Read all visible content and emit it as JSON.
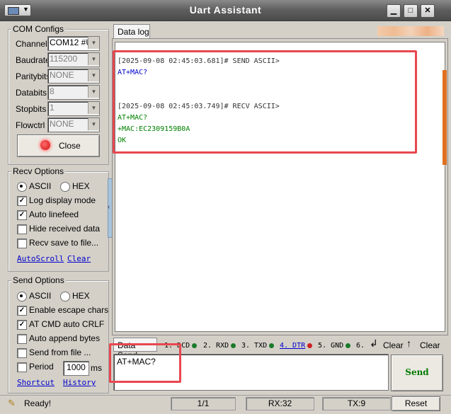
{
  "window": {
    "title": "Uart Assistant",
    "menu_icon": "monitor-icon"
  },
  "com_configs": {
    "legend": "COM Configs",
    "fields": [
      {
        "label": "Channel",
        "value": "COM12 #U",
        "disabled": false
      },
      {
        "label": "Baudrate",
        "value": "115200",
        "disabled": true
      },
      {
        "label": "Paritybits",
        "value": "NONE",
        "disabled": true
      },
      {
        "label": "Databits",
        "value": "8",
        "disabled": true
      },
      {
        "label": "Stopbits",
        "value": "1",
        "disabled": true
      },
      {
        "label": "Flowctrl",
        "value": "NONE",
        "disabled": true
      }
    ],
    "close_label": "Close"
  },
  "recv_options": {
    "legend": "Recv Options",
    "ascii": "ASCII",
    "hex": "HEX",
    "checks": [
      {
        "label": "Log display mode",
        "checked": true
      },
      {
        "label": "Auto linefeed",
        "checked": true
      },
      {
        "label": "Hide received data",
        "checked": false
      },
      {
        "label": "Recv save to file...",
        "checked": false
      }
    ],
    "autoscroll": "AutoScroll",
    "clear": "Clear"
  },
  "send_options": {
    "legend": "Send Options",
    "ascii": "ASCII",
    "hex": "HEX",
    "checks": [
      {
        "label": "Enable escape chars",
        "checked": true
      },
      {
        "label": "AT CMD auto CRLF",
        "checked": true
      },
      {
        "label": "Auto append bytes",
        "checked": false
      },
      {
        "label": "Send from file ...",
        "checked": false
      }
    ],
    "period": {
      "label": "Period",
      "value": "1000",
      "unit": "ms",
      "checked": false
    },
    "shortcut": "Shortcut",
    "history": "History"
  },
  "data_log": {
    "tab": "Data log",
    "entries": [
      {
        "header": "[2025-09-08 02:45:03.681]# SEND ASCII>",
        "lines": [
          "AT+MAC?"
        ],
        "color": "#0000cc"
      },
      {
        "header": "[2025-09-08 02:45:03.749]# RECV ASCII>",
        "lines": [
          "AT+MAC?",
          "+MAC:EC2309159B0A",
          "OK"
        ],
        "color": "#008000"
      }
    ]
  },
  "data_send": {
    "tab": "Data Send",
    "pins": [
      {
        "label": "1. DCD",
        "color": "#1a7a2a"
      },
      {
        "label": "2. RXD",
        "color": "#1a7a2a"
      },
      {
        "label": "3. TXD",
        "color": "#1a7a2a"
      },
      {
        "label": "4. DTR",
        "color": "#cc2222",
        "link": true
      },
      {
        "label": "5. GND",
        "color": "#1a7a2a"
      },
      {
        "label": "6.",
        "color": ""
      }
    ],
    "clear1": "Clear",
    "clear2": "Clear",
    "input": "AT+MAC?",
    "send_label": "Send"
  },
  "status": {
    "ready": "Ready!",
    "page": "1/1",
    "rx": "RX:32",
    "tx": "TX:9",
    "reset": "Reset"
  },
  "colors": {
    "highlight": "#e8474f"
  }
}
